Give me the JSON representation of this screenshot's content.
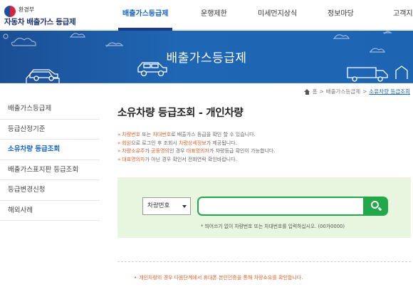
{
  "header": {
    "ministry": "환경부",
    "site_title": "자동차 배출가스 등급제",
    "nav": [
      {
        "label": "배출가스등급제",
        "active": true
      },
      {
        "label": "운행제한",
        "active": false
      },
      {
        "label": "미세먼지상식",
        "active": false
      },
      {
        "label": "정보마당",
        "active": false
      },
      {
        "label": "고객지",
        "active": false
      }
    ]
  },
  "banner": {
    "title": "배출가스등급제"
  },
  "breadcrumb": {
    "home_icon": "home-icon",
    "items": [
      "홈",
      "배출가스등급제",
      "소유차량 등급조회"
    ]
  },
  "sidebar": {
    "items": [
      {
        "label": "배출가스등급제",
        "active": false
      },
      {
        "label": "등급산정기준",
        "active": false
      },
      {
        "label": "소유차량 등급조회",
        "active": true
      },
      {
        "label": "배출가스표지판 등급조회",
        "active": false
      },
      {
        "label": "등급변경신청",
        "active": false
      },
      {
        "label": "해외사례",
        "active": false
      }
    ]
  },
  "main": {
    "page_title": "소유차량 등급조회 - 개인차량",
    "notices": [
      {
        "bullet": "»",
        "hl1": "차량번호",
        "t1": " 또는 ",
        "hl2": "차대번호",
        "t2": "로 배출가스 등급을 확인 할 수 있습니다."
      },
      {
        "bullet": "»",
        "hl1": "회원",
        "t1": "으로 로그인 후 조회시 ",
        "hl2": "차량상세정보",
        "t2": "가 제공됩니다."
      },
      {
        "bullet": "»",
        "hl1": "차량소유주",
        "t1": "가 ",
        "hl2": "공동명의",
        "t2": "인 경우 ",
        "hl3": "대표명의자",
        "t3": "가 차량등급 확인이 가능합니다."
      },
      {
        "bullet": "»",
        "hl1": "대표명의자",
        "t1": "가 아닌 경우 확인서 전화연락 확인바랍니다.",
        "hl2": "",
        "t2": ""
      }
    ],
    "search": {
      "select_value": "차량번호",
      "input_value": "",
      "input_placeholder": "",
      "hint": "* 띄어쓰기 없이 차량번호 또는 차대번호를 입력하십시오. (00가0000)",
      "button_icon": "search-icon"
    },
    "footnote": {
      "bullet": "•",
      "text": "개인차량의 경우 다음단계에서 휴대폰 본인인증을 통해 차량소유를 확인합니다."
    }
  },
  "colors": {
    "accent": "#1564c0",
    "banner": "#1d64b2",
    "search_green": "#21a84b",
    "search_bg": "#e9f6df",
    "notice_highlight": "#e2602b"
  }
}
